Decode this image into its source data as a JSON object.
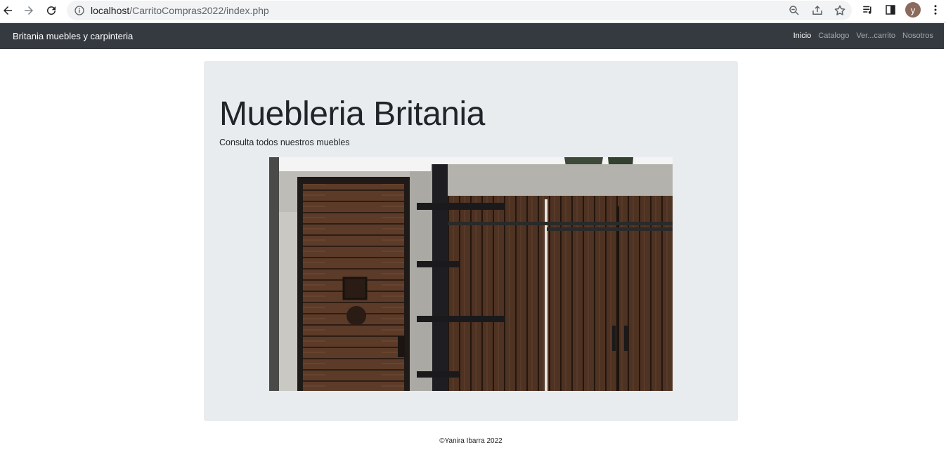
{
  "browser": {
    "url_host": "localhost",
    "url_path": "/CarritoCompras2022/index.php",
    "profile_initial": "y"
  },
  "navbar": {
    "brand": "Britania muebles y carpinteria",
    "links": [
      {
        "label": "Inicio",
        "active": true
      },
      {
        "label": "Catalogo",
        "active": false
      },
      {
        "label": "Ver...carrito",
        "active": false
      },
      {
        "label": "Nosotros",
        "active": false
      }
    ]
  },
  "hero": {
    "title": "Muebleria Britania",
    "lead": "Consulta todos nuestros muebles"
  },
  "footer": {
    "text": "©Yanira Ibarra 2022"
  },
  "colors": {
    "navbar_bg": "#343a40",
    "jumbotron_bg": "#e9ecef",
    "wood": "#5a3a28"
  }
}
